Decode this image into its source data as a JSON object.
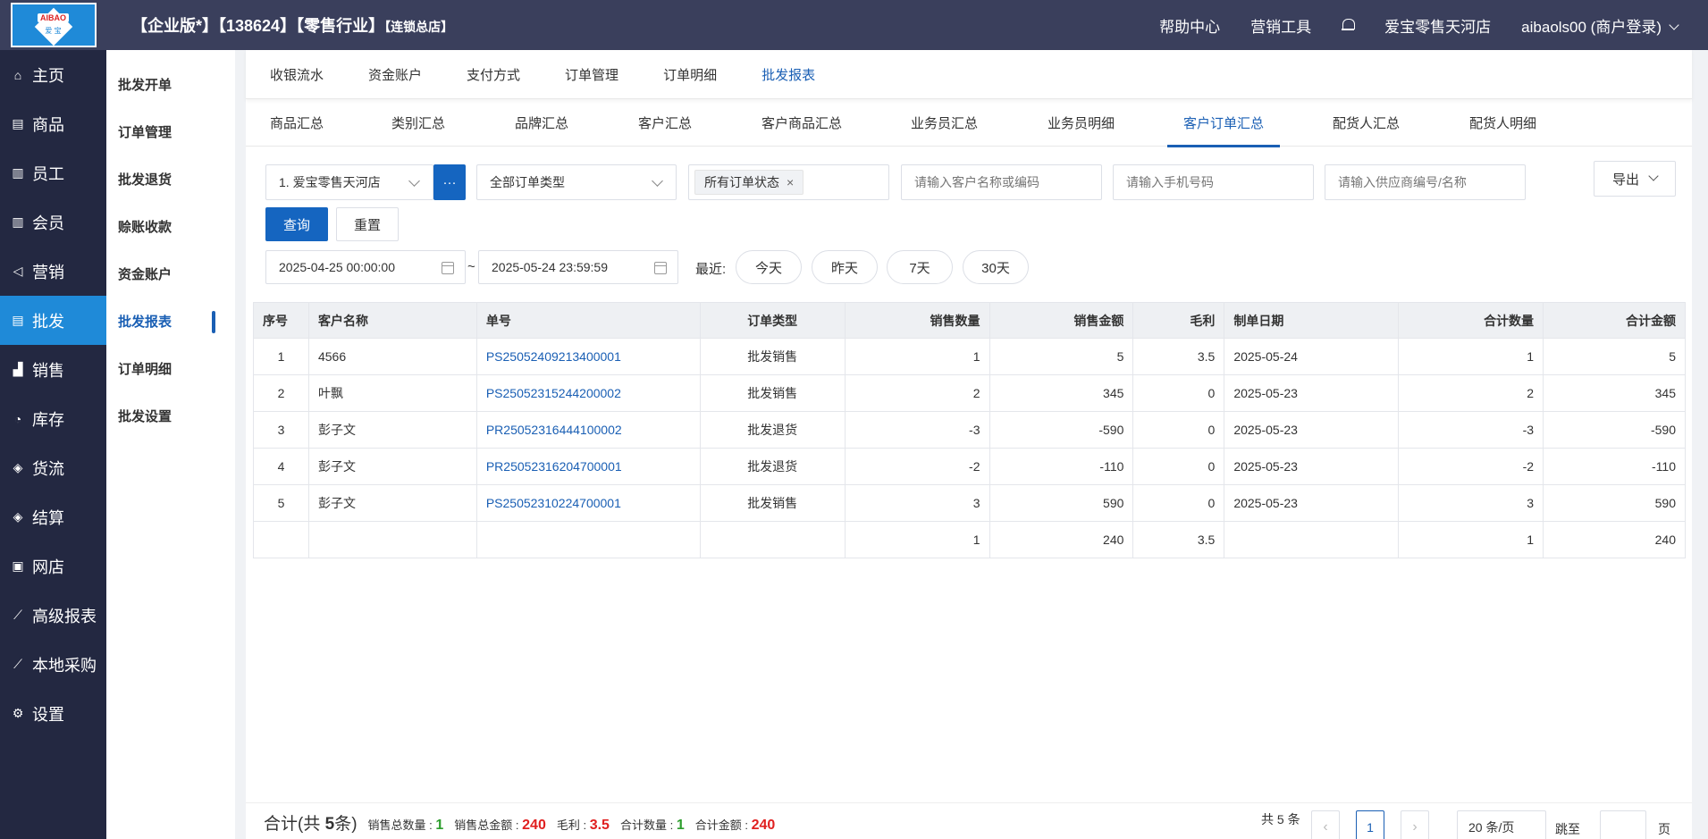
{
  "header": {
    "logo_top": "AIBAO",
    "logo_bottom": "爱 宝",
    "title_main": "【企业版*】【138624】【零售行业】",
    "title_sub": "【连锁总店】",
    "links": [
      "帮助中心",
      "营销工具"
    ],
    "store": "爱宝零售天河店",
    "user": "aibaols00 (商户登录)"
  },
  "leftnav": [
    {
      "label": "主页",
      "icon": "home-icon",
      "glyph": "⌂"
    },
    {
      "label": "商品",
      "icon": "goods-icon",
      "glyph": "▤"
    },
    {
      "label": "员工",
      "icon": "staff-icon",
      "glyph": "▥"
    },
    {
      "label": "会员",
      "icon": "member-icon",
      "glyph": "▥"
    },
    {
      "label": "营销",
      "icon": "marketing-icon",
      "glyph": "◁"
    },
    {
      "label": "批发",
      "icon": "wholesale-icon",
      "glyph": "▤"
    },
    {
      "label": "销售",
      "icon": "sales-icon",
      "glyph": "▟"
    },
    {
      "label": "库存",
      "icon": "stock-icon",
      "glyph": "◔"
    },
    {
      "label": "货流",
      "icon": "flow-icon",
      "glyph": "◈"
    },
    {
      "label": "结算",
      "icon": "settle-icon",
      "glyph": "◈"
    },
    {
      "label": "网店",
      "icon": "shop-icon",
      "glyph": "▣"
    },
    {
      "label": "高级报表",
      "icon": "report-icon",
      "glyph": "⟋"
    },
    {
      "label": "本地采购",
      "icon": "purchase-icon",
      "glyph": "⟋"
    },
    {
      "label": "设置",
      "icon": "settings-icon",
      "glyph": "⚙"
    }
  ],
  "subnav": [
    "批发开单",
    "订单管理",
    "批发退货",
    "赊账收款",
    "资金账户",
    "批发报表",
    "订单明细",
    "批发设置"
  ],
  "tabs1": [
    "收银流水",
    "资金账户",
    "支付方式",
    "订单管理",
    "订单明细",
    "批发报表"
  ],
  "tabs2": [
    "商品汇总",
    "类别汇总",
    "品牌汇总",
    "客户汇总",
    "客户商品汇总",
    "业务员汇总",
    "业务员明细",
    "客户订单汇总",
    "配货人汇总",
    "配货人明细"
  ],
  "filters": {
    "store": "1. 爱宝零售天河店",
    "more": "···",
    "order_type": "全部订单类型",
    "status_tag": "所有订单状态",
    "customer_ph": "请输入客户名称或编码",
    "phone_ph": "请输入手机号码",
    "supplier_ph": "请输入供应商编号/名称",
    "export": "导出",
    "query": "查询",
    "reset": "重置",
    "date_from": "2025-04-25 00:00:00",
    "date_sep": "~",
    "date_to": "2025-05-24 23:59:59",
    "recent_label": "最近:",
    "quick": [
      "今天",
      "昨天",
      "7天",
      "30天"
    ]
  },
  "table": {
    "headers": [
      "序号",
      "客户名称",
      "单号",
      "订单类型",
      "销售数量",
      "销售金额",
      "毛利",
      "制单日期",
      "合计数量",
      "合计金额"
    ],
    "rows": [
      [
        "1",
        "4566",
        "PS25052409213400001",
        "批发销售",
        "1",
        "5",
        "3.5",
        "2025-05-24",
        "1",
        "5"
      ],
      [
        "2",
        "叶飘",
        "PS25052315244200002",
        "批发销售",
        "2",
        "345",
        "0",
        "2025-05-23",
        "2",
        "345"
      ],
      [
        "3",
        "彭子文",
        "PR25052316444100002",
        "批发退货",
        "-3",
        "-590",
        "0",
        "2025-05-23",
        "-3",
        "-590"
      ],
      [
        "4",
        "彭子文",
        "PR25052316204700001",
        "批发退货",
        "-2",
        "-110",
        "0",
        "2025-05-23",
        "-2",
        "-110"
      ],
      [
        "5",
        "彭子文",
        "PS25052310224700001",
        "批发销售",
        "3",
        "590",
        "0",
        "2025-05-23",
        "3",
        "590"
      ]
    ],
    "total": [
      "",
      "",
      "",
      "",
      "1",
      "240",
      "3.5",
      "",
      "1",
      "240"
    ]
  },
  "footer": {
    "sum_prefix": "合计(共",
    "sum_count": "5",
    "sum_suffix": "条)",
    "qty_label": "销售总数量 :",
    "qty": "1",
    "amount_label": "销售总金额 :",
    "amount": "240",
    "profit_label": "毛利 :",
    "profit": "3.5",
    "total_qty_label": "合计数量 :",
    "total_qty": "1",
    "total_amount_label": "合计金额 :",
    "total_amount": "240",
    "total_items": "共 5 条",
    "page": "1",
    "page_size": "20 条/页",
    "jump_label": "跳至",
    "page_unit": "页"
  }
}
